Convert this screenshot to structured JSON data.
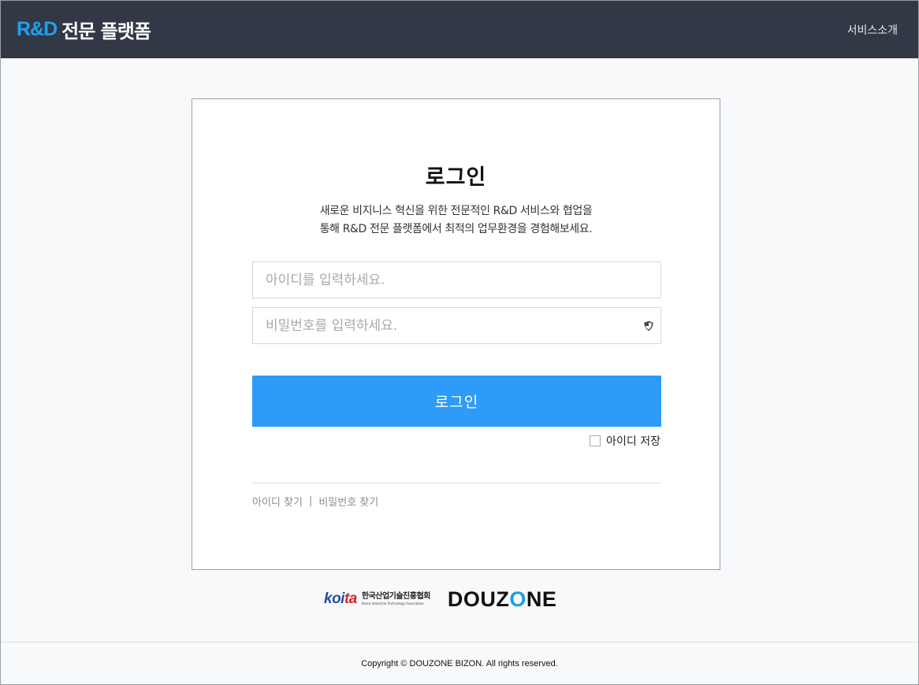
{
  "header": {
    "brand_accent": "R&D",
    "brand_text": "전문 플랫폼",
    "nav_link": "서비스소개"
  },
  "login": {
    "title": "로그인",
    "subtitle_line1": "새로운 비지니스 혁신을 위한 전문적인 R&D 서비스와 협업을",
    "subtitle_line2": "통해 R&D 전문 플랫폼에서 최적의 업무환경을 경험해보세요.",
    "id_placeholder": "아이디를 입력하세요.",
    "pw_placeholder": "비밀번호를 입력하세요.",
    "login_button": "로그인",
    "remember_id": "아이디 저장",
    "find_id": "아이디 찾기",
    "separator": "|",
    "find_pw": "비밀번호 찾기"
  },
  "logos": {
    "koita_mark_blue": "koi",
    "koita_mark_red": "ta",
    "koita_kr": "한국산업기술진흥협회",
    "koita_en": "Korea Industrial Technology Association",
    "douzone_d": "D",
    "douzone_o1": "O",
    "douzone_mid": "UZ",
    "douzone_o2": "O",
    "douzone_end": "NE"
  },
  "footer": {
    "copyright": "Copyright © DOUZONE BIZON. All rights reserved."
  },
  "colors": {
    "header_bg": "#323846",
    "brand_accent": "#1da1f2",
    "button_bg": "#2d9bf7"
  },
  "icons": {
    "password_toggle": "shield-icon"
  }
}
